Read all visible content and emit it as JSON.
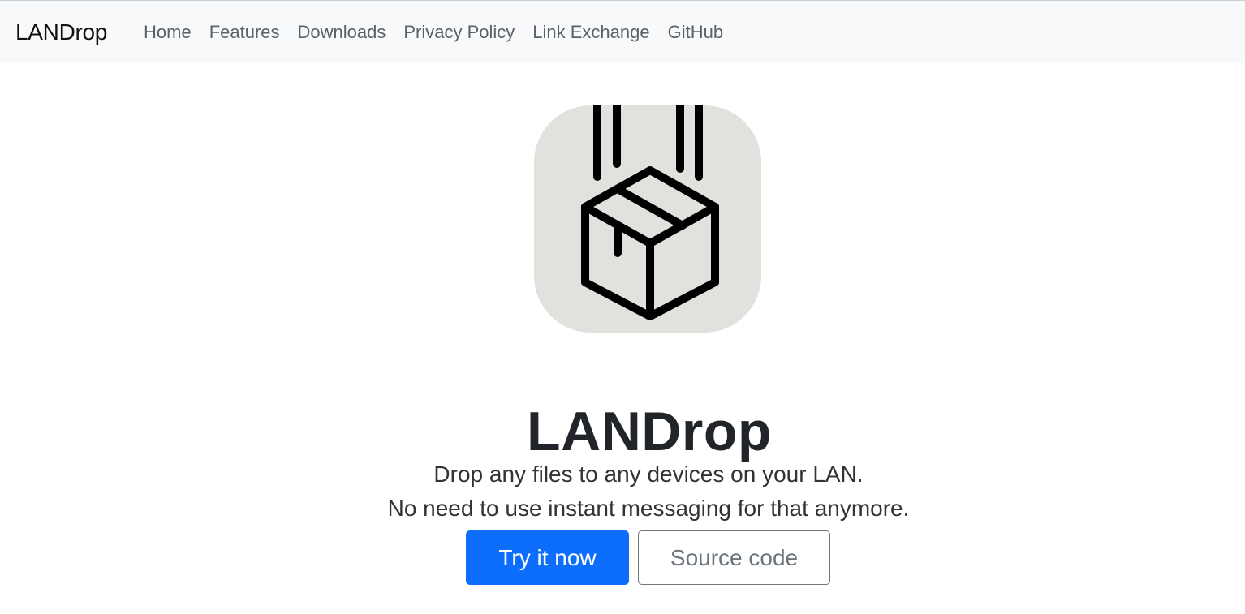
{
  "navbar": {
    "brand": "LANDrop",
    "items": [
      {
        "label": "Home"
      },
      {
        "label": "Features"
      },
      {
        "label": "Downloads"
      },
      {
        "label": "Privacy Policy"
      },
      {
        "label": "Link Exchange"
      },
      {
        "label": "GitHub"
      }
    ]
  },
  "hero": {
    "logo_icon": "falling-box-icon",
    "logo_bg_color": "#e2e1de",
    "title": "LANDrop",
    "lead_line1": "Drop any files to any devices on your LAN.",
    "lead_line2": "No need to use instant messaging for that anymore.",
    "primary_button": "Try it now",
    "secondary_button": "Source code"
  },
  "colors": {
    "navbar_bg": "#f8f9fa",
    "primary": "#0d6efd",
    "secondary": "#6c757d",
    "text_dark": "#212529"
  }
}
